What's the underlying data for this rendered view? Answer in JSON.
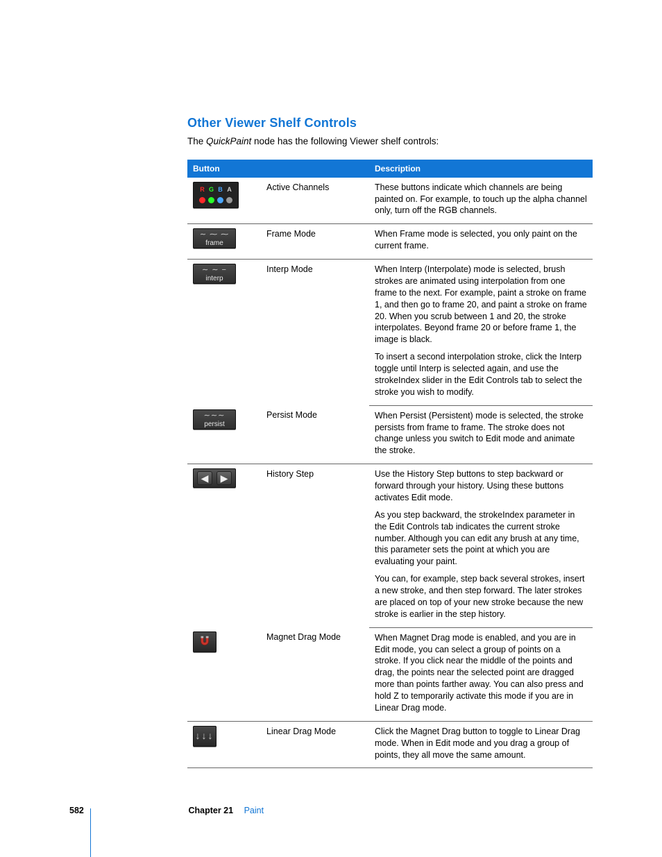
{
  "section": {
    "title": "Other Viewer Shelf Controls",
    "intro_prefix": "The ",
    "intro_em": "QuickPaint",
    "intro_suffix": " node has the following Viewer shelf controls:"
  },
  "table": {
    "header_button": "Button",
    "header_description": "Description",
    "rows": [
      {
        "key": "active-channels",
        "button_label": "Active Channels",
        "desc": [
          "These buttons indicate which channels are being painted on. For example, to touch up the alpha channel only, turn off the RGB channels."
        ]
      },
      {
        "key": "frame-mode",
        "icon_caption": "frame",
        "button_label": "Frame Mode",
        "desc": [
          "When Frame mode is selected, you only paint on the current frame."
        ]
      },
      {
        "key": "interp-mode",
        "icon_caption": "interp",
        "button_label": "Interp Mode",
        "desc": [
          "When Interp (Interpolate) mode is selected, brush strokes are animated using interpolation from one frame to the next. For example, paint a stroke on frame 1, and then go to frame 20, and paint a stroke on frame 20. When you scrub between 1 and 20, the stroke interpolates. Beyond frame 20 or before frame 1, the image is black.",
          "To insert a second interpolation stroke, click the Interp toggle until Interp is selected again, and use the strokeIndex slider in the Edit Controls tab to select the stroke you wish to modify."
        ]
      },
      {
        "key": "persist-mode",
        "icon_caption": "persist",
        "button_label": "Persist Mode",
        "desc": [
          "When Persist (Persistent) mode is selected, the stroke persists from frame to frame. The stroke does not change unless you switch to Edit mode and animate the stroke."
        ]
      },
      {
        "key": "history-step",
        "button_label": "History Step",
        "desc": [
          "Use the History Step buttons to step backward or forward through your history. Using these buttons activates Edit mode.",
          "As you step backward, the strokeIndex parameter in the Edit Controls tab indicates the current stroke number. Although you can edit any brush at any time, this parameter sets the point at which you are evaluating your paint.",
          "You can, for example, step back several strokes, insert a new stroke, and then step forward. The later strokes are placed on top of your new stroke because the new stroke is earlier in the step history."
        ]
      },
      {
        "key": "magnet-drag",
        "button_label": "Magnet Drag Mode",
        "desc": [
          "When Magnet Drag mode is enabled, and you are in Edit mode, you can select a group of points on a stroke. If you click near the middle of the points and drag, the points near the selected point are dragged more than points farther away. You can also press and hold Z to temporarily activate this mode if you are in Linear Drag mode."
        ]
      },
      {
        "key": "linear-drag",
        "button_label": "Linear Drag Mode",
        "desc": [
          "Click the Magnet Drag button to toggle to Linear Drag mode. When in Edit mode and you drag a group of points, they all move the same amount."
        ]
      }
    ]
  },
  "footer": {
    "page_number": "582",
    "chapter_label": "Chapter 21",
    "chapter_title": "Paint"
  }
}
